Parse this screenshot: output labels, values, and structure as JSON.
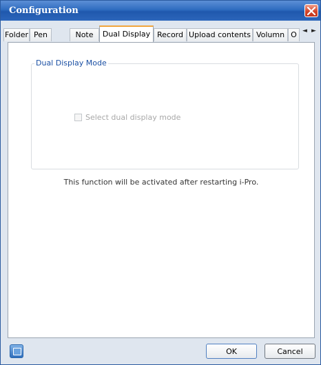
{
  "window": {
    "title": "Configuration"
  },
  "tabs": [
    {
      "label": "Folder"
    },
    {
      "label": "Pen"
    },
    {
      "label": "Note"
    },
    {
      "label": "Dual Display"
    },
    {
      "label": "Record"
    },
    {
      "label": "Upload contents"
    },
    {
      "label": "Volumn"
    },
    {
      "label": "O"
    }
  ],
  "active_tab": "Dual Display",
  "tab_scroll": {
    "left": "◄",
    "right": "►"
  },
  "dual_display": {
    "group_title": "Dual Display Mode",
    "checkbox_label": "Select dual display mode",
    "checkbox_checked": false,
    "checkbox_enabled": false,
    "info": "This function will be activated after restarting i-Pro."
  },
  "buttons": {
    "ok": "OK",
    "cancel": "Cancel"
  },
  "icons": {
    "close": "close-icon",
    "bottom_left": "display-icon"
  },
  "colors": {
    "title_bar": "#2f6cc0",
    "active_tab_accent": "#f1a53c",
    "group_title": "#1a4fa3",
    "close_button": "#d4452a"
  }
}
